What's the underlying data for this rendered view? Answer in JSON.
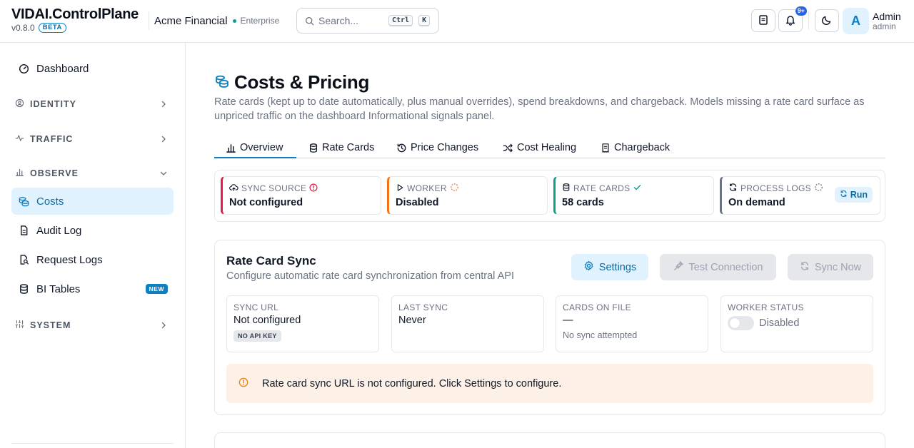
{
  "header": {
    "brand": "VIDAI.ControlPlane",
    "version": "v0.8.0",
    "beta": "BETA",
    "org_name": "Acme Financial",
    "org_tier": "Enterprise",
    "search_placeholder": "Search...",
    "shortcut_keys": [
      "Ctrl",
      "K"
    ],
    "notification_count": "9+",
    "user_initial": "A",
    "user_name": "Admin",
    "user_role": "admin"
  },
  "sidebar": {
    "dashboard": "Dashboard",
    "sections": {
      "identity": "IDENTITY",
      "traffic": "TRAFFIC",
      "observe": "OBSERVE",
      "system": "SYSTEM"
    },
    "observe_items": [
      {
        "label": "Costs",
        "icon": "coins-icon",
        "active": true
      },
      {
        "label": "Audit Log",
        "icon": "document-icon"
      },
      {
        "label": "Request Logs",
        "icon": "file-search-icon"
      },
      {
        "label": "BI Tables",
        "icon": "database-icon",
        "badge": "NEW"
      }
    ]
  },
  "page": {
    "title": "Costs & Pricing",
    "description": "Rate cards (kept up to date automatically, plus manual overrides), spend breakdowns, and chargeback. Models missing a rate card surface as unpriced traffic on the dashboard Informational signals panel.",
    "tabs": [
      {
        "label": "Overview",
        "icon": "bar-chart-icon",
        "active": true
      },
      {
        "label": "Rate Cards",
        "icon": "database-icon"
      },
      {
        "label": "Price Changes",
        "icon": "history-icon"
      },
      {
        "label": "Cost Healing",
        "icon": "shuffle-icon"
      },
      {
        "label": "Chargeback",
        "icon": "receipt-icon"
      }
    ]
  },
  "status": {
    "sync_source": {
      "label": "SYNC SOURCE",
      "value": "Not configured",
      "color": "#e11d48"
    },
    "worker": {
      "label": "WORKER",
      "value": "Disabled",
      "color": "#f97316"
    },
    "rate_cards": {
      "label": "RATE CARDS",
      "value": "58 cards",
      "color": "#0e9f8c"
    },
    "process_logs": {
      "label": "PROCESS LOGS",
      "value": "On demand",
      "color": "#6b7280",
      "action": "Run"
    }
  },
  "sync": {
    "title": "Rate Card Sync",
    "subtitle": "Configure automatic rate card synchronization from central API",
    "settings_label": "Settings",
    "test_label": "Test Connection",
    "sync_now_label": "Sync Now",
    "sync_url": {
      "label": "SYNC URL",
      "value": "Not configured",
      "chip": "NO API KEY"
    },
    "last_sync": {
      "label": "LAST SYNC",
      "value": "Never"
    },
    "cards_on_file": {
      "label": "CARDS ON FILE",
      "value": "—",
      "note": "No sync attempted"
    },
    "worker_status": {
      "label": "WORKER STATUS",
      "value": "Disabled"
    },
    "alert": "Rate card sync URL is not configured. Click Settings to configure."
  },
  "colors": {
    "accent": "#0e7fc0",
    "accent_bg": "#e0f2fe",
    "warning_bg": "#fdf1e7",
    "warning": "#ea8a1e"
  }
}
